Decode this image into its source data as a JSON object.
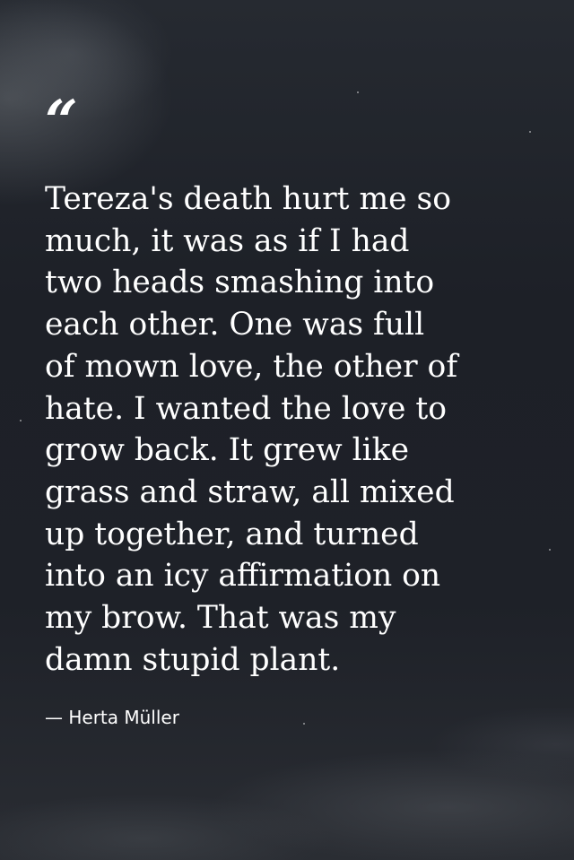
{
  "quote": {
    "mark": "“",
    "text": "Tereza's death hurt me so\nmuch, it was as if I had\ntwo heads smashing into\neach other. One was full\nof mown love, the other of\nhate. I wanted the love to\ngrow back. It grew like\ngrass and straw, all mixed\nup together, and turned\ninto an icy affirmation on\nmy brow. That was my\ndamn stupid plant.",
    "attribution": "— Herta Müller"
  },
  "colors": {
    "text": "#ffffff",
    "background": "#1f2229"
  }
}
